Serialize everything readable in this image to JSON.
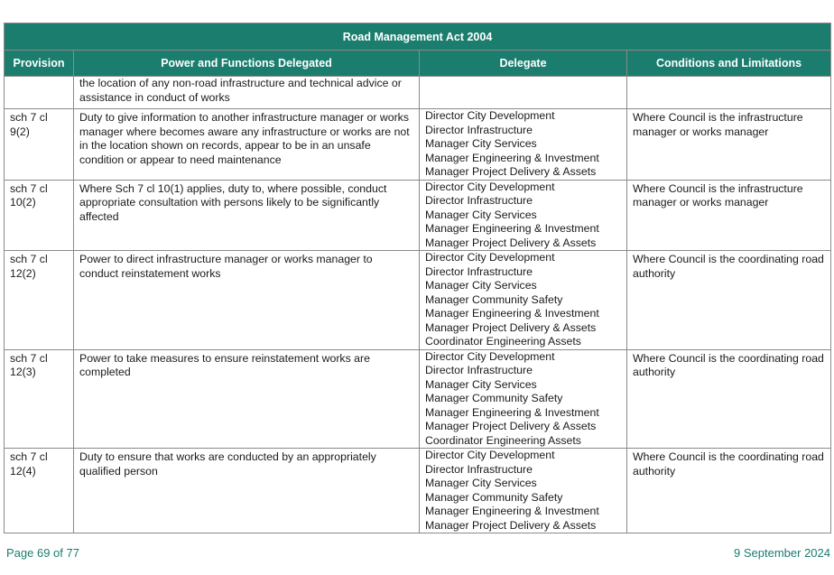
{
  "table": {
    "title": "Road Management Act 2004",
    "headers": [
      "Provision",
      "Power and Functions Delegated",
      "Delegate",
      "Conditions and Limitations"
    ],
    "continuation": {
      "provision": "",
      "power": "the location of any  non-road infrastructure and technical advice or assistance in conduct of works",
      "delegates": [],
      "conditions": ""
    },
    "rows": [
      {
        "provision": "sch 7 cl 9(2)",
        "power": "Duty to give information to another infrastructure manager or works manager where becomes aware any infrastructure or works are not in the location shown on records, appear to be in an unsafe condition or appear to need maintenance",
        "delegates": [
          "Director City Development",
          "Director Infrastructure",
          "Manager City Services",
          "Manager Engineering & Investment",
          "Manager Project Delivery & Assets"
        ],
        "conditions": "Where Council is the infrastructure manager or works manager"
      },
      {
        "provision": "sch 7 cl 10(2)",
        "power": "Where Sch 7 cl 10(1) applies, duty to, where possible, conduct appropriate consultation with persons likely to be significantly affected",
        "delegates": [
          "Director City Development",
          "Director Infrastructure",
          "Manager City Services",
          "Manager Engineering & Investment",
          "Manager Project Delivery & Assets"
        ],
        "conditions": "Where Council is the infrastructure manager or works manager"
      },
      {
        "provision": "sch 7 cl 12(2)",
        "power": "Power to direct infrastructure manager or works manager to conduct reinstatement works",
        "delegates": [
          "Director City Development",
          "Director Infrastructure",
          "Manager City Services",
          "Manager Community Safety",
          "Manager Engineering & Investment",
          "Manager Project Delivery & Assets",
          "Coordinator Engineering Assets"
        ],
        "conditions": "Where Council is the coordinating road authority"
      },
      {
        "provision": "sch 7 cl 12(3)",
        "power": "Power to take measures to ensure reinstatement works are completed",
        "delegates": [
          "Director City Development",
          "Director Infrastructure",
          "Manager City Services",
          "Manager Community Safety",
          "Manager Engineering & Investment",
          "Manager Project Delivery & Assets",
          "Coordinator Engineering Assets"
        ],
        "conditions": "Where Council is the coordinating road authority"
      },
      {
        "provision": "sch 7 cl 12(4)",
        "power": "Duty to ensure that works are conducted by an appropriately qualified person",
        "delegates": [
          "Director City Development",
          "Director Infrastructure",
          "Manager City Services",
          "Manager Community Safety",
          "Manager Engineering & Investment",
          "Manager Project Delivery & Assets"
        ],
        "conditions": "Where Council is the coordinating road authority"
      }
    ]
  },
  "footer": {
    "page": "Page 69 of 77",
    "date": "9 September 2024"
  },
  "colors": {
    "header_bg": "#1b7d6e",
    "footer_text": "#1b7d6e"
  }
}
